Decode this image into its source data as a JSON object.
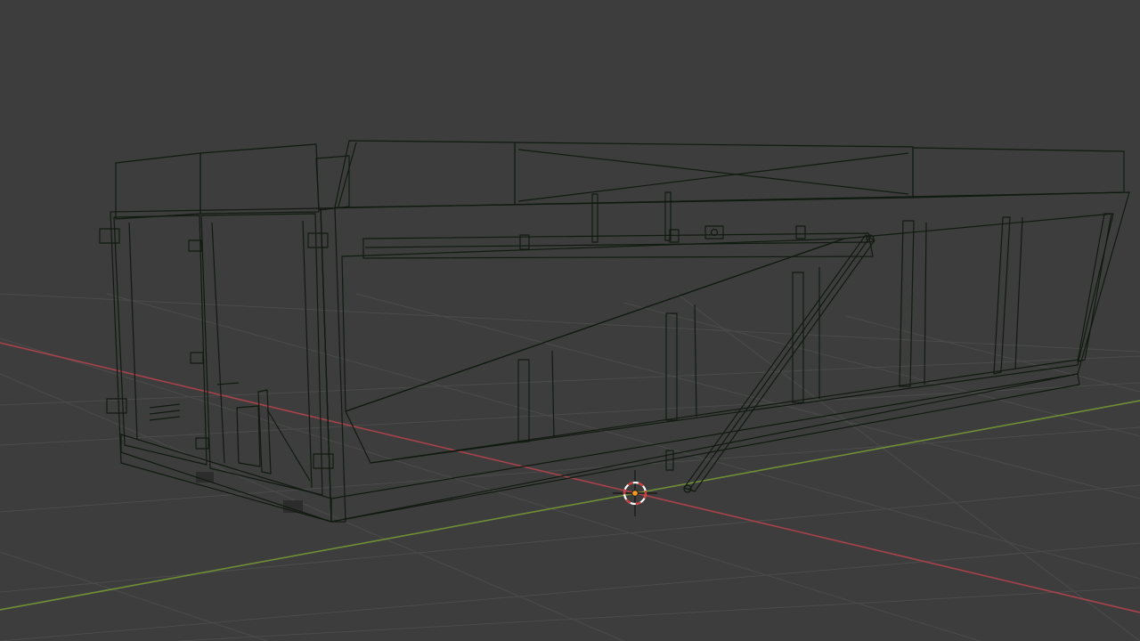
{
  "viewport": {
    "mode": "solid",
    "colors": {
      "background": "#3d3d3d",
      "grid": "#4b4b4b",
      "axis_x": "#a8424a",
      "axis_y": "#6e8f36",
      "body_light": "#5f9d57",
      "body_mid": "#4f7f46",
      "body_dark": "#426a3b",
      "rib": "#84c27b",
      "rim_red": "#8f2020",
      "rim_red_dark": "#6e1c1c",
      "edge": "#111a10",
      "cursor_ring_red": "#d23a3a",
      "cursor_ring_white": "#ffffff",
      "origin": "#ff9a1a"
    }
  },
  "scene": {
    "object": {
      "name_icon": "roll-off-container-mesh",
      "selected": false
    },
    "cursor_icon": "3d-cursor-icon",
    "origin_icon": "object-origin-dot"
  }
}
